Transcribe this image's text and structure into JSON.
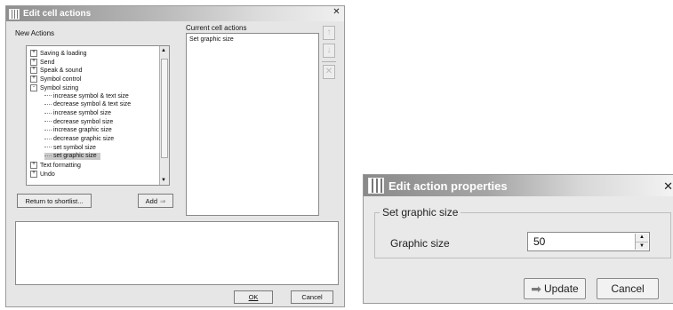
{
  "window1": {
    "title": "Edit cell actions",
    "new_actions_label": "New Actions",
    "current_label": "Current cell actions",
    "tree": [
      {
        "label": "Saving & loading",
        "indent": 0,
        "expander": "+",
        "selected": false
      },
      {
        "label": "Send",
        "indent": 0,
        "expander": "+",
        "selected": false
      },
      {
        "label": "Speak & sound",
        "indent": 0,
        "expander": "+",
        "selected": false
      },
      {
        "label": "Symbol control",
        "indent": 0,
        "expander": "+",
        "selected": false
      },
      {
        "label": "Symbol sizing",
        "indent": 0,
        "expander": "-",
        "selected": false
      },
      {
        "label": "increase symbol & text size",
        "indent": 1,
        "expander": "",
        "selected": false
      },
      {
        "label": "decrease symbol & text size",
        "indent": 1,
        "expander": "",
        "selected": false
      },
      {
        "label": "increase symbol size",
        "indent": 1,
        "expander": "",
        "selected": false
      },
      {
        "label": "decrease symbol size",
        "indent": 1,
        "expander": "",
        "selected": false
      },
      {
        "label": "increase graphic size",
        "indent": 1,
        "expander": "",
        "selected": false
      },
      {
        "label": "decrease graphic size",
        "indent": 1,
        "expander": "",
        "selected": false
      },
      {
        "label": "set symbol size",
        "indent": 1,
        "expander": "",
        "selected": false
      },
      {
        "label": "set graphic size",
        "indent": 1,
        "expander": "",
        "selected": true
      },
      {
        "label": "Text formatting",
        "indent": 0,
        "expander": "+",
        "selected": false
      },
      {
        "label": "Undo",
        "indent": 0,
        "expander": "+",
        "selected": false
      }
    ],
    "current_actions": [
      "Set graphic size"
    ],
    "return_button": "Return to shortlist...",
    "add_button": "Add",
    "ok_button": "OK",
    "cancel_button": "Cancel"
  },
  "window2": {
    "title": "Edit action properties",
    "group_title": "Set graphic size",
    "field_label": "Graphic size",
    "field_value": "50",
    "update_button": "Update",
    "cancel_button": "Cancel"
  },
  "colors": {
    "titlebar_dark": "#8f8f8f",
    "selection": "#c9c9c9",
    "dialog_bg": "#e6e6e6"
  }
}
